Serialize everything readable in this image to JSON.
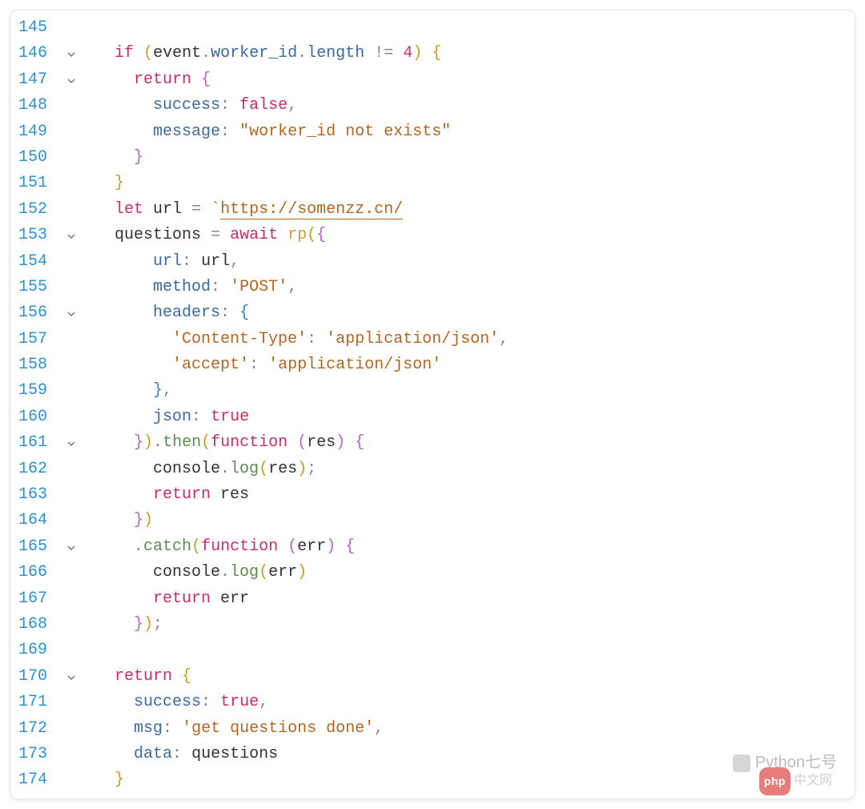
{
  "watermark": {
    "label": "Python七号"
  },
  "watermark2": {
    "badge": "php",
    "text": "中文网"
  },
  "lines": [
    {
      "n": "145",
      "fold": "",
      "html": ""
    },
    {
      "n": "146",
      "fold": "v",
      "html": "  <span class='tok-kw'>if</span> <span class='tok-paren-y'>(</span><span class='tok-var'>event</span><span class='tok-punct'>.</span><span class='tok-prop'>worker_id</span><span class='tok-punct'>.</span><span class='tok-prop'>length</span> <span class='tok-op'>!=</span> <span class='tok-num'>4</span><span class='tok-paren-y'>)</span> <span class='tok-paren-y'>{</span>"
    },
    {
      "n": "147",
      "fold": "v",
      "html": "    <span class='tok-kw'>return</span> <span class='tok-paren-p'>{</span>"
    },
    {
      "n": "148",
      "fold": "",
      "html": "      <span class='tok-prop'>success</span><span class='tok-punct'>:</span> <span class='tok-bool'>false</span><span class='tok-punct'>,</span>"
    },
    {
      "n": "149",
      "fold": "",
      "html": "      <span class='tok-prop'>message</span><span class='tok-punct'>:</span> <span class='tok-str'>\"worker_id not exists\"</span>"
    },
    {
      "n": "150",
      "fold": "",
      "html": "    <span class='tok-paren-p'>}</span>"
    },
    {
      "n": "151",
      "fold": "",
      "html": "  <span class='tok-paren-y'>}</span>"
    },
    {
      "n": "152",
      "fold": "",
      "html": "  <span class='tok-kw'>let</span> <span class='tok-var'>url</span> <span class='tok-op'>=</span> <span class='tok-template'>`</span><span class='tok-url'>https://somenzz.cn/</span>"
    },
    {
      "n": "153",
      "fold": "v",
      "html": "  <span class='tok-var'>questions</span> <span class='tok-op'>=</span> <span class='tok-kw'>await</span> <span class='tok-call'>rp</span><span class='tok-paren-y'>(</span><span class='tok-paren-p'>{</span>"
    },
    {
      "n": "154",
      "fold": "",
      "html": "      <span class='tok-prop'>url</span><span class='tok-punct'>:</span> <span class='tok-var'>url</span><span class='tok-punct'>,</span>"
    },
    {
      "n": "155",
      "fold": "",
      "html": "      <span class='tok-prop'>method</span><span class='tok-punct'>:</span> <span class='tok-str'>'POST'</span><span class='tok-punct'>,</span>"
    },
    {
      "n": "156",
      "fold": "v",
      "html": "      <span class='tok-prop'>headers</span><span class='tok-punct'>:</span> <span class='tok-paren-b'>{</span>"
    },
    {
      "n": "157",
      "fold": "",
      "html": "        <span class='tok-str'>'Content-Type'</span><span class='tok-punct'>:</span> <span class='tok-str'>'application/json'</span><span class='tok-punct'>,</span>"
    },
    {
      "n": "158",
      "fold": "",
      "html": "        <span class='tok-str'>'accept'</span><span class='tok-punct'>:</span> <span class='tok-str'>'application/json'</span>"
    },
    {
      "n": "159",
      "fold": "",
      "html": "      <span class='tok-paren-b'>}</span><span class='tok-punct'>,</span>"
    },
    {
      "n": "160",
      "fold": "",
      "html": "      <span class='tok-prop'>json</span><span class='tok-punct'>:</span> <span class='tok-bool'>true</span>"
    },
    {
      "n": "161",
      "fold": "v",
      "html": "    <span class='tok-paren-p'>}</span><span class='tok-paren-y'>)</span><span class='tok-punct'>.</span><span class='tok-meth'>then</span><span class='tok-paren-y'>(</span><span class='tok-kw'>function</span> <span class='tok-paren-p'>(</span><span class='tok-var'>res</span><span class='tok-paren-p'>)</span> <span class='tok-paren-p'>{</span>"
    },
    {
      "n": "162",
      "fold": "",
      "html": "      <span class='tok-var'>console</span><span class='tok-punct'>.</span><span class='tok-meth'>log</span><span class='tok-paren-y'>(</span><span class='tok-var'>res</span><span class='tok-paren-y'>)</span><span class='tok-punct'>;</span>"
    },
    {
      "n": "163",
      "fold": "",
      "html": "      <span class='tok-kw'>return</span> <span class='tok-var'>res</span>"
    },
    {
      "n": "164",
      "fold": "",
      "html": "    <span class='tok-paren-p'>}</span><span class='tok-paren-y'>)</span>"
    },
    {
      "n": "165",
      "fold": "v",
      "html": "    <span class='tok-punct'>.</span><span class='tok-meth'>catch</span><span class='tok-paren-y'>(</span><span class='tok-kw'>function</span> <span class='tok-paren-p'>(</span><span class='tok-var'>err</span><span class='tok-paren-p'>)</span> <span class='tok-paren-p'>{</span>"
    },
    {
      "n": "166",
      "fold": "",
      "html": "      <span class='tok-var'>console</span><span class='tok-punct'>.</span><span class='tok-meth'>log</span><span class='tok-paren-y'>(</span><span class='tok-var'>err</span><span class='tok-paren-y'>)</span>"
    },
    {
      "n": "167",
      "fold": "",
      "html": "      <span class='tok-kw'>return</span> <span class='tok-var'>err</span>"
    },
    {
      "n": "168",
      "fold": "",
      "html": "    <span class='tok-paren-p'>}</span><span class='tok-paren-y'>)</span><span class='tok-punct'>;</span>"
    },
    {
      "n": "169",
      "fold": "",
      "html": ""
    },
    {
      "n": "170",
      "fold": "v",
      "html": "  <span class='tok-kw'>return</span> <span class='tok-paren-y'>{</span>"
    },
    {
      "n": "171",
      "fold": "",
      "html": "    <span class='tok-prop'>success</span><span class='tok-punct'>:</span> <span class='tok-bool'>true</span><span class='tok-punct'>,</span>"
    },
    {
      "n": "172",
      "fold": "",
      "html": "    <span class='tok-prop'>msg</span><span class='tok-punct'>:</span> <span class='tok-str'>'get questions done'</span><span class='tok-punct'>,</span>"
    },
    {
      "n": "173",
      "fold": "",
      "html": "    <span class='tok-prop'>data</span><span class='tok-punct'>:</span> <span class='tok-var'>questions</span>"
    },
    {
      "n": "174",
      "fold": "",
      "html": "  <span class='tok-paren-y'>}</span>"
    }
  ]
}
